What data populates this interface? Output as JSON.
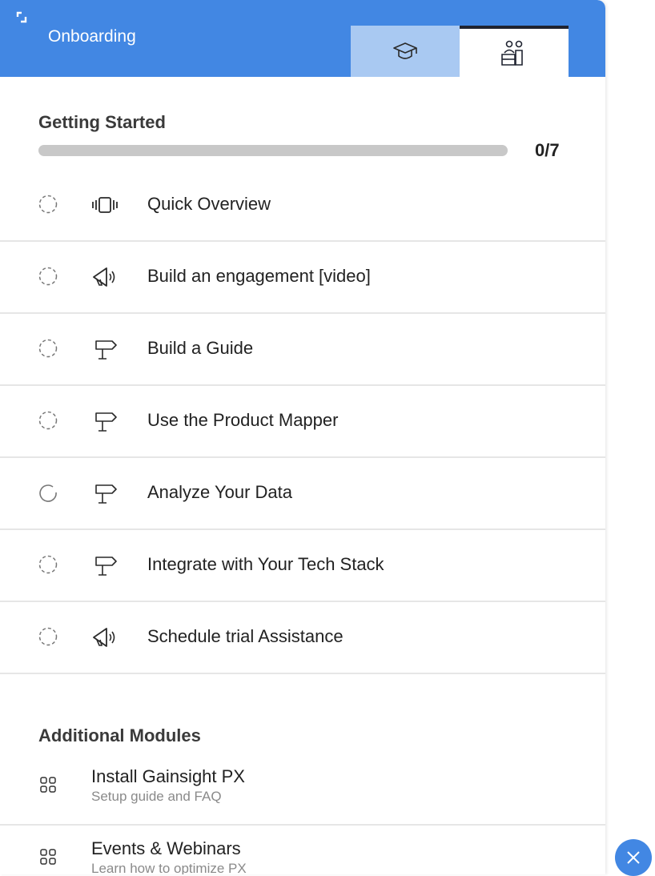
{
  "header": {
    "title": "Onboarding",
    "tabs": [
      {
        "icon": "graduation-cap-icon",
        "active": false
      },
      {
        "icon": "people-icon",
        "active": true
      }
    ],
    "color": "#4287e3"
  },
  "getting_started": {
    "title": "Getting Started",
    "progress_text": "0/7",
    "progress_fraction": 0,
    "items": [
      {
        "label": "Quick Overview",
        "status": "not-started",
        "type_icon": "slideshow-icon"
      },
      {
        "label": "Build an engagement [video]",
        "status": "not-started",
        "type_icon": "megaphone-icon"
      },
      {
        "label": "Build a Guide",
        "status": "not-started",
        "type_icon": "signpost-icon"
      },
      {
        "label": "Use the Product Mapper",
        "status": "not-started",
        "type_icon": "signpost-icon"
      },
      {
        "label": "Analyze Your Data",
        "status": "in-progress",
        "type_icon": "signpost-icon"
      },
      {
        "label": "Integrate with Your Tech Stack",
        "status": "not-started",
        "type_icon": "signpost-icon"
      },
      {
        "label": "Schedule trial Assistance",
        "status": "not-started",
        "type_icon": "megaphone-icon"
      }
    ]
  },
  "additional_modules": {
    "title": "Additional Modules",
    "items": [
      {
        "title": "Install Gainsight PX",
        "subtitle": "Setup guide and FAQ",
        "icon": "module-grid-icon"
      },
      {
        "title": "Events & Webinars",
        "subtitle": "Learn how to optimize PX",
        "icon": "module-grid-icon"
      }
    ]
  },
  "close_button": {
    "icon": "close-icon"
  }
}
